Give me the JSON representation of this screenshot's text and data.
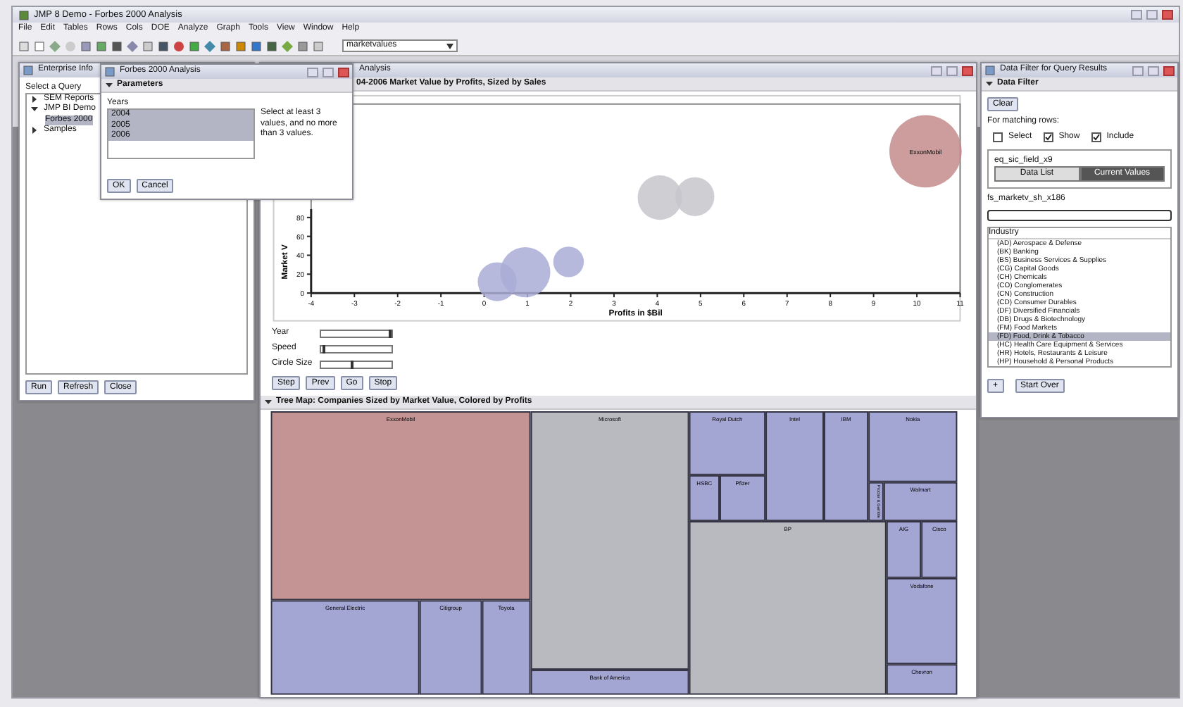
{
  "window": {
    "title": "JMP 8 Demo - Forbes 2000 Analysis"
  },
  "menu": [
    "File",
    "Edit",
    "Tables",
    "Rows",
    "Cols",
    "DOE",
    "Analyze",
    "Graph",
    "Tools",
    "View",
    "Window",
    "Help"
  ],
  "toolbar": {
    "combo": "marketvalues"
  },
  "query_window": {
    "title": "Enterprise Info",
    "label": "Select a Query",
    "tree": [
      {
        "label": "SEM Reports",
        "expanded": false
      },
      {
        "label": "JMP BI Demo",
        "expanded": true,
        "children": [
          {
            "label": "Forbes 2000",
            "selected": true
          }
        ]
      },
      {
        "label": "Samples",
        "expanded": false
      }
    ],
    "buttons": [
      "Run",
      "Refresh",
      "Close"
    ]
  },
  "dialog": {
    "title": "Forbes 2000 Analysis",
    "section": "Parameters",
    "list_label": "Years",
    "years": [
      {
        "label": "2004",
        "selected": true
      },
      {
        "label": "2005",
        "selected": true
      },
      {
        "label": "2006",
        "selected": true
      }
    ],
    "note": "Select at least 3 values, and no more than 3 values.",
    "buttons": [
      "OK",
      "Cancel"
    ]
  },
  "report": {
    "title": "Analysis",
    "chart_title": "04-2006 Market Value by Profits, Sized by Sales",
    "chart_data": {
      "type": "scatter",
      "xlabel": "Profits in $Bil",
      "ylabel": "Market V",
      "xlim": [
        -4,
        11
      ],
      "ylim": [
        0,
        200
      ],
      "xticks": [
        -4,
        -3,
        -2,
        -1,
        0,
        1,
        2,
        3,
        4,
        5,
        6,
        7,
        8,
        9,
        10,
        11
      ],
      "yticks": [
        0,
        20,
        40,
        60,
        80
      ],
      "x": [
        0.3,
        0.95,
        1.95,
        4.06,
        4.87,
        10.2
      ],
      "series": [
        {
          "color": "#a9abd6",
          "values": [
            12,
            null,
            null,
            null,
            null,
            null
          ]
        },
        {
          "color": "#a9abd6",
          "values": [
            null,
            22,
            null,
            null,
            null,
            null
          ]
        },
        {
          "color": "#a9abd6",
          "values": [
            null,
            null,
            33,
            null,
            null,
            null
          ]
        },
        {
          "color": "#c5c5cb",
          "values": [
            null,
            null,
            null,
            101,
            null,
            null
          ]
        },
        {
          "color": "#c5c5cb",
          "values": [
            null,
            null,
            null,
            null,
            102,
            null
          ]
        },
        {
          "color": "#c48c8c",
          "values": [
            null,
            null,
            null,
            null,
            null,
            150
          ]
        }
      ],
      "annotations": [
        {
          "x": 10.2,
          "y": 150,
          "text": "ExxonMobil"
        }
      ]
    },
    "sliders": [
      {
        "label": "Year",
        "level": 0.95
      },
      {
        "label": "Speed",
        "level": 0.02
      },
      {
        "label": "Circle Size",
        "level": 0.42
      }
    ],
    "buttons": [
      "Step",
      "Prev",
      "Go",
      "Stop"
    ],
    "treemap_title": "Tree Map: Companies Sized by Market Value, Colored by Profits",
    "treemap": [
      {
        "label": "ExxonMobil",
        "color": "#c49494"
      },
      {
        "label": "General Electric",
        "color": "#a3a5d3"
      },
      {
        "label": "Citigroup",
        "color": "#a3a5d3"
      },
      {
        "label": "Toyota",
        "color": "#a3a5d3"
      },
      {
        "label": "Microsoft",
        "color": "#b9b9c0"
      },
      {
        "label": "Bank of America",
        "color": "#a3a5d3"
      },
      {
        "label": "Royal Dutch",
        "color": "#a3a5d3"
      },
      {
        "label": "HSBC",
        "color": "#a3a5d3"
      },
      {
        "label": "Pfizer",
        "color": "#a3a5d3"
      },
      {
        "label": "Intel",
        "color": "#a3a5d3"
      },
      {
        "label": "IBM",
        "color": "#a3a5d3"
      },
      {
        "label": "Nokia",
        "color": "#a3a5d3"
      },
      {
        "label": "Walmart",
        "color": "#a3a5d3"
      },
      {
        "label": "Procter & Gamble",
        "color": "#a3a5d3"
      },
      {
        "label": "BP",
        "color": "#b9b9c0"
      },
      {
        "label": "AIG",
        "color": "#a3a5d3"
      },
      {
        "label": "Cisco",
        "color": "#a3a5d3"
      },
      {
        "label": "Vodafone",
        "color": "#a3a5d3"
      },
      {
        "label": "Chevron",
        "color": "#a3a5d3"
      }
    ]
  },
  "filter_window": {
    "title": "Data Filter for Query Results",
    "section": "Data Filter",
    "clear": "Clear",
    "rows_label": "For matching rows:",
    "options": [
      {
        "label": "Select",
        "checked": false
      },
      {
        "label": "Show",
        "checked": true
      },
      {
        "label": "Include",
        "checked": true
      }
    ],
    "column": "eq_sic_field_x9",
    "tabs": [
      {
        "label": "Data List",
        "selected": false
      },
      {
        "label": "Current Values",
        "selected": true
      }
    ],
    "range_column": "fs_marketv_sh_x186",
    "list_label": "Industry",
    "industries": [
      {
        "label": "(AD) Aerospace & Defense",
        "selected": false
      },
      {
        "label": "(BK) Banking",
        "selected": false
      },
      {
        "label": "(BS) Business Services & Supplies",
        "selected": false
      },
      {
        "label": "(CG) Capital Goods",
        "selected": false
      },
      {
        "label": "(CH) Chemicals",
        "selected": false
      },
      {
        "label": "(CO) Conglomerates",
        "selected": false
      },
      {
        "label": "(CN) Construction",
        "selected": false
      },
      {
        "label": "(CD) Consumer Durables",
        "selected": false
      },
      {
        "label": "(DF) Diversified Financials",
        "selected": false
      },
      {
        "label": "(DB) Drugs & Biotechnology",
        "selected": false
      },
      {
        "label": "(FM) Food Markets",
        "selected": false
      },
      {
        "label": "(FD) Food, Drink & Tobacco",
        "selected": true
      },
      {
        "label": "(HC) Health Care Equipment & Services",
        "selected": false
      },
      {
        "label": "(HR) Hotels, Restaurants & Leisure",
        "selected": false
      },
      {
        "label": "(HP) Household & Personal Products",
        "selected": false
      }
    ],
    "add": "+",
    "start_over": "Start Over"
  }
}
